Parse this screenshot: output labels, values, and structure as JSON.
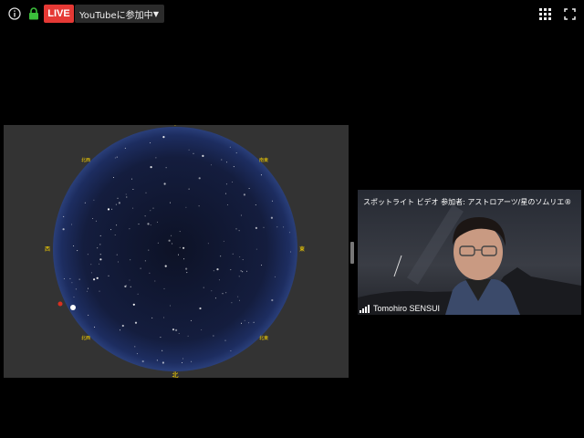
{
  "toolbar": {
    "info_icon": "info-icon",
    "lock_icon": "lock-icon",
    "live_label": "LIVE",
    "youtube_label": "YouTubeに参加中",
    "grid_icon": "grid-icon",
    "fullscreen_icon": "fullscreen-icon",
    "live_color": "#e53935",
    "lock_color": "#3bbf3b"
  },
  "sky_chart": {
    "directions": {
      "north": "北",
      "east": "東",
      "west": "西",
      "northeast": "北東",
      "northwest": "北西",
      "southeast": "南東",
      "southwest": "南西"
    }
  },
  "video_tile": {
    "title": "スポットライト ビデオ 参加者: アストロアーツ/星のソムリエ®",
    "participant_name": "Tomohiro SENSUI",
    "signal_icon": "signal-icon"
  }
}
